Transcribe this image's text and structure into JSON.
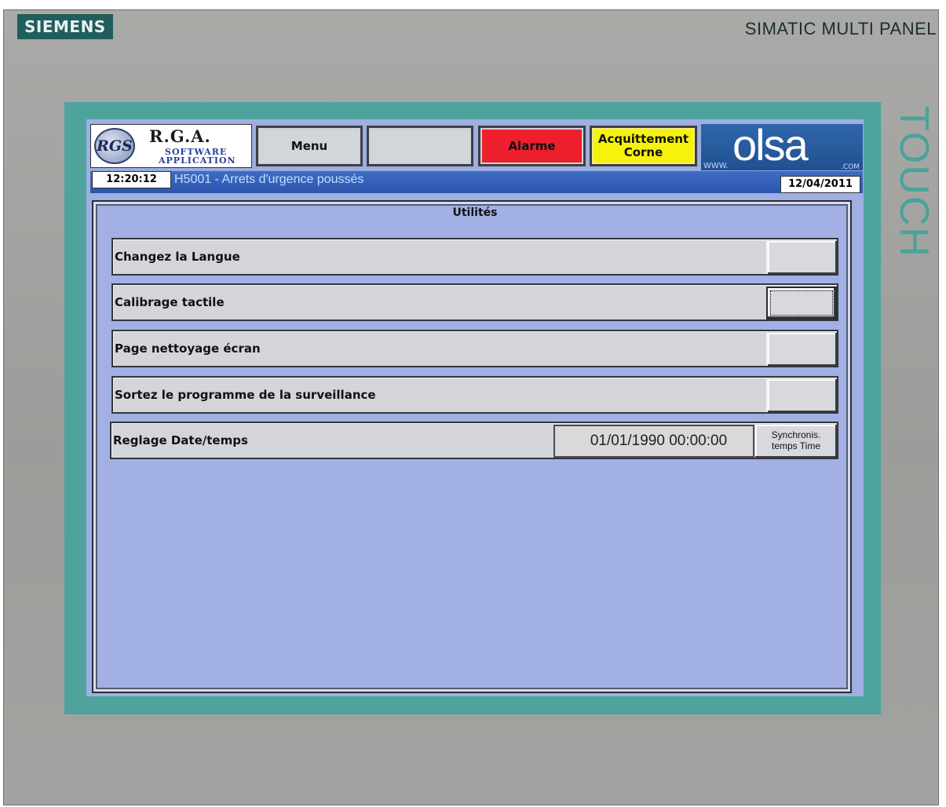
{
  "device": {
    "brand": "SIEMENS",
    "model": "SIMATIC MULTI PANEL",
    "side_label": "TOUCH"
  },
  "header": {
    "logo": {
      "emblem": "RGS",
      "title": "R.G.A.",
      "subtitle_line1": "SOFTWARE",
      "subtitle_line2": "APPLICATION"
    },
    "buttons": {
      "menu": "Menu",
      "blank": "",
      "alarm": "Alarme",
      "ack_line1": "Acquittement",
      "ack_line2": "Corne"
    },
    "partner_logo": {
      "www": "WWW.",
      "name": "olsa",
      "com": ".COM"
    },
    "time": "12:20:12",
    "alarm_message": "H5001 - Arrets d'urgence poussés",
    "date": "12/04/2011"
  },
  "colors": {
    "alarm": "#ee1f2c",
    "acknowledge": "#f6f20d",
    "screen_background": "#a0afe2",
    "status_bar": "#2c56ad"
  },
  "panel": {
    "title": "Utilités",
    "rows": [
      {
        "label": "Changez la Langue"
      },
      {
        "label": "Calibrage tactile"
      },
      {
        "label": "Page nettoyage écran"
      },
      {
        "label": "Sortez le programme de la surveillance"
      }
    ],
    "datetime_row": {
      "label": "Reglage Date/temps",
      "value": "01/01/1990 00:00:00",
      "sync_line1": "Synchronis.",
      "sync_line2": "temps Time"
    }
  }
}
